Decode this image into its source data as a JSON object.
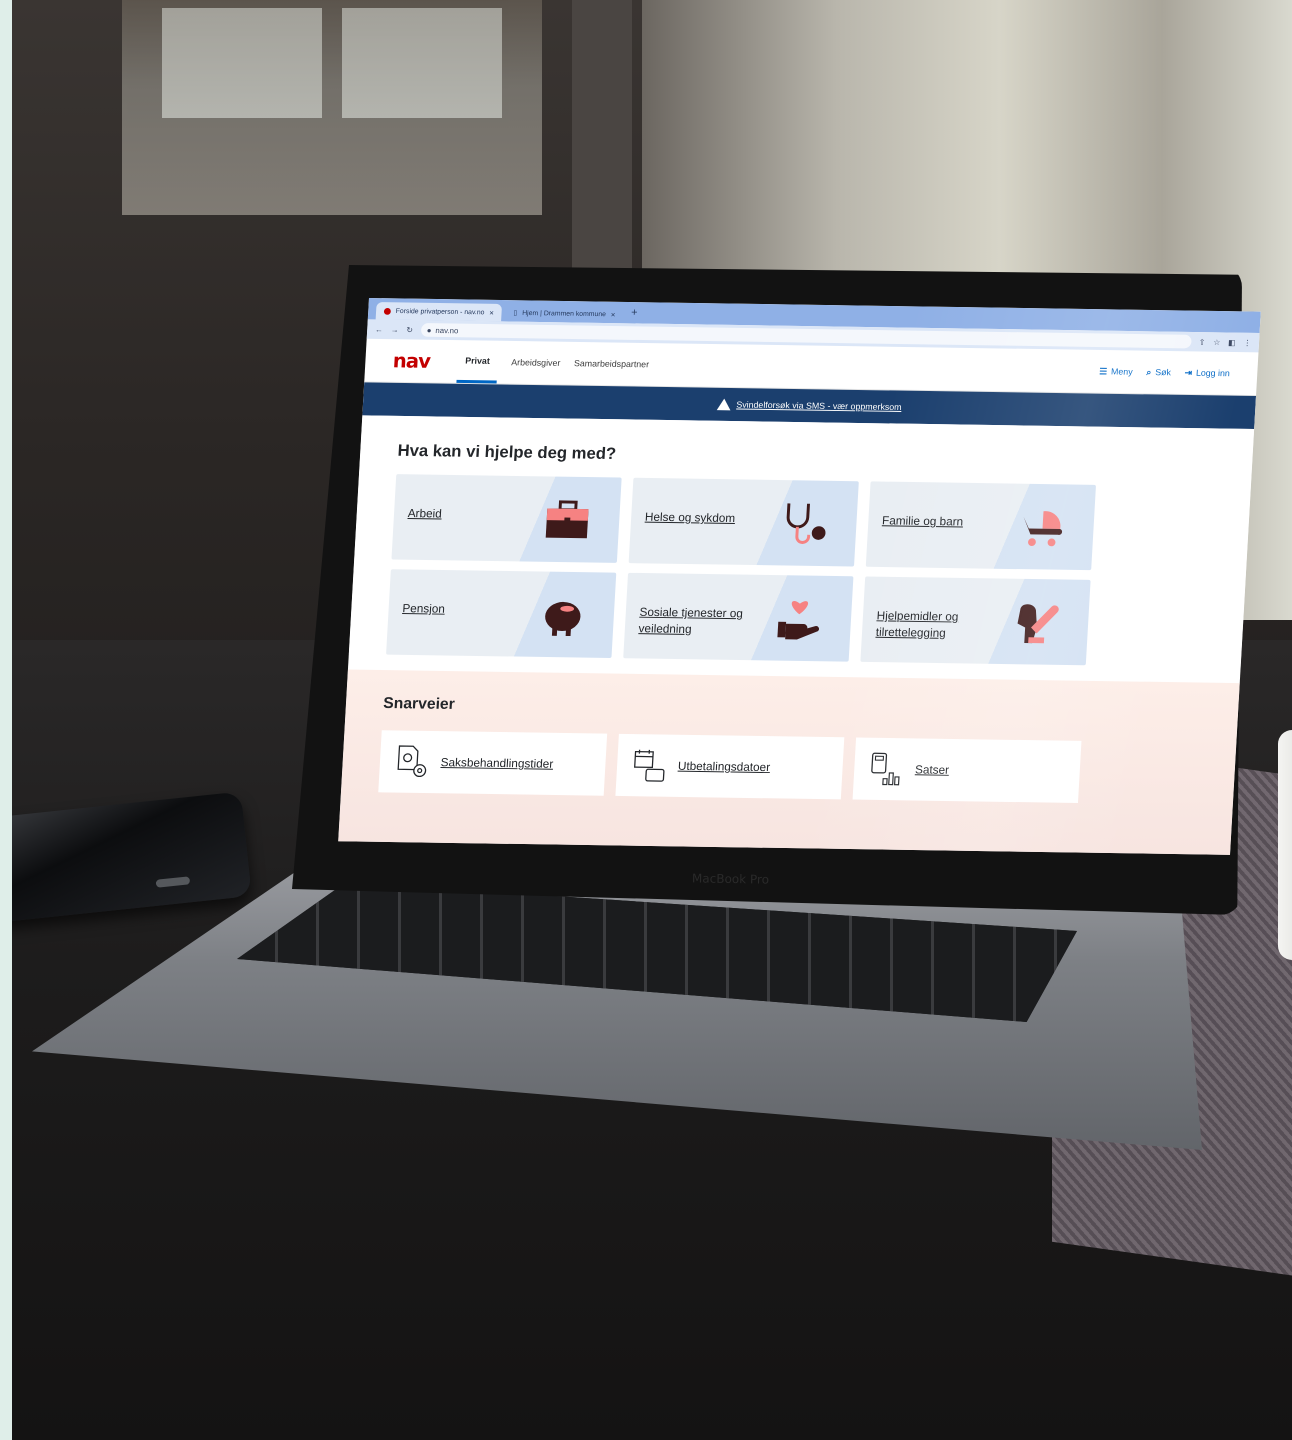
{
  "browser": {
    "tabs": [
      {
        "label": "Forside privatperson - nav.no"
      },
      {
        "label": "Hjem | Drammen kommune"
      }
    ],
    "new_tab": "+",
    "url": "nav.no"
  },
  "site": {
    "logo": "nav",
    "nav": {
      "privat": "Privat",
      "arbeidsgiver": "Arbeidsgiver",
      "samarbeid": "Samarbeidspartner",
      "meny": "Meny",
      "sok": "Søk",
      "logg_inn": "Logg inn"
    },
    "banner": "Svindelforsøk via SMS - vær oppmerksom",
    "heading": "Hva kan vi hjelpe deg med?",
    "cards": [
      {
        "label": "Arbeid",
        "icon": "briefcase-icon"
      },
      {
        "label": "Helse og sykdom",
        "icon": "stethoscope-icon"
      },
      {
        "label": "Familie og barn",
        "icon": "stroller-icon"
      },
      {
        "label": "Pensjon",
        "icon": "piggy-bank-icon"
      },
      {
        "label": "Sosiale tjenester og veiledning",
        "icon": "heart-hand-icon"
      },
      {
        "label": "Hjelpemidler og tilrettelegging",
        "icon": "guide-dog-icon"
      }
    ],
    "shortcuts_title": "Snarveier",
    "shortcuts": [
      {
        "label": "Saksbehandlingstider",
        "icon": "document-gear-icon"
      },
      {
        "label": "Utbetalingsdatoer",
        "icon": "calendar-wallet-icon"
      },
      {
        "label": "Satser",
        "icon": "calculator-chart-icon"
      }
    ]
  },
  "device": {
    "brand": "MacBook Pro"
  },
  "colors": {
    "nav_red": "#c30000",
    "banner_blue": "#1b3f6e",
    "link_blue": "#0067c5",
    "icon_dark": "#3e1a1a",
    "icon_pink": "#f68282"
  }
}
